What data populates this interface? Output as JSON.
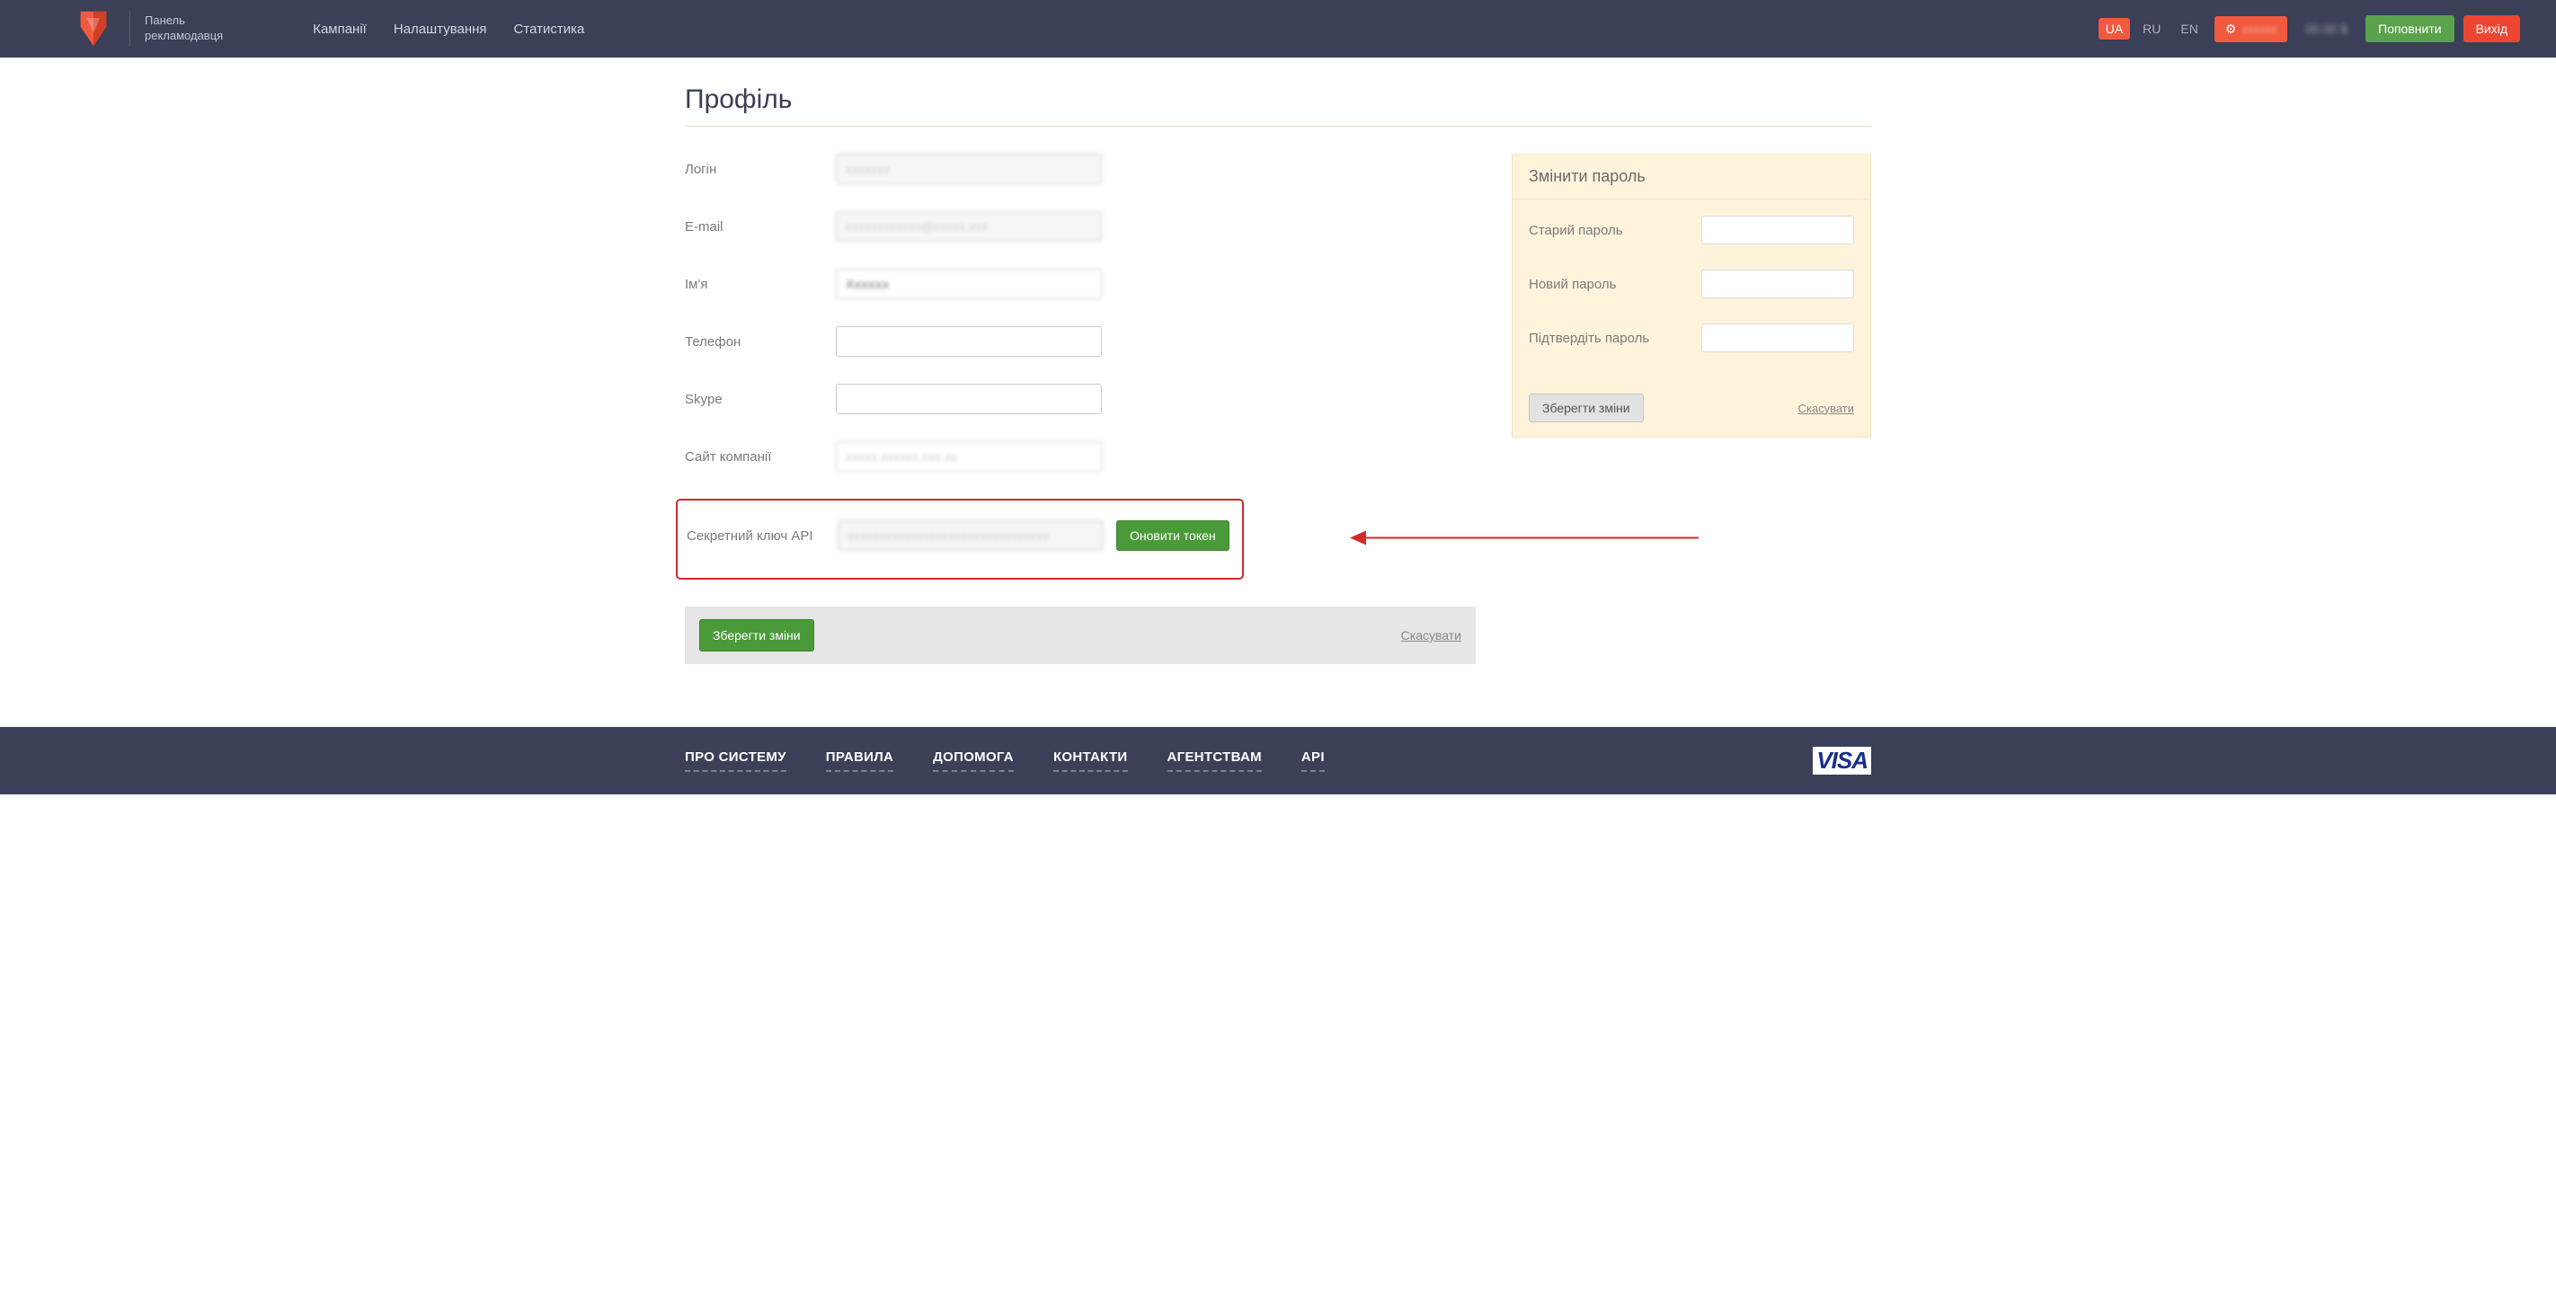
{
  "brand": {
    "line1": "Панель",
    "line2": "рекламодавця"
  },
  "nav": {
    "campaigns": "Кампанії",
    "settings": "Налаштування",
    "stats": "Статистика"
  },
  "lang": {
    "ua": "UA",
    "ru": "RU",
    "en": "EN"
  },
  "header": {
    "settings_blur": "xxxxxx",
    "balance": "00.00 $",
    "topup": "Поповнити",
    "logout": "Вихід"
  },
  "page": {
    "title": "Профіль"
  },
  "form": {
    "login_label": "Логін",
    "login_value": "xxxxxxx",
    "email_label": "E-mail",
    "email_value": "xxxxxxxxxxxx@xxxxx.xxx",
    "name_label": "Ім'я",
    "name_value": "Xxxxxx",
    "phone_label": "Телефон",
    "phone_value": "",
    "skype_label": "Skype",
    "skype_value": "",
    "site_label": "Сайт компанії",
    "site_value": "xxxxx.xxxxxx.xxx.xx",
    "api_label": "Секретний ключ API",
    "api_value": "xxxxxxxxxxxxxxxxxxxxxxxxxxxxxxxx",
    "update_token": "Оновити токен"
  },
  "actions": {
    "save": "Зберегти зміни",
    "cancel": "Скасувати"
  },
  "password": {
    "title": "Змінити пароль",
    "old": "Старий пароль",
    "new": "Новий пароль",
    "confirm": "Підтвердіть пароль",
    "save": "Зберегти зміни",
    "cancel": "Скасувати"
  },
  "footer": {
    "about": "ПРО СИСТЕМУ",
    "rules": "ПРАВИЛА",
    "help": "ДОПОМОГА",
    "contacts": "КОНТАКТИ",
    "agencies": "АГЕНТСТВАМ",
    "api": "API",
    "visa": "VISA"
  }
}
